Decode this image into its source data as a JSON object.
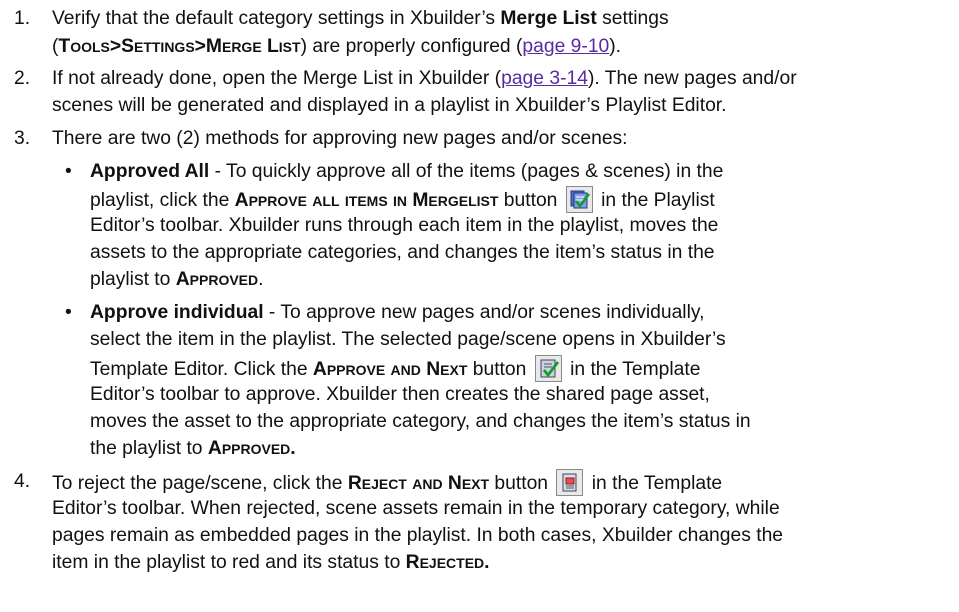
{
  "steps": {
    "s1": {
      "num": "1.",
      "l1_pre": "Verify that the default category settings in Xbuilder’s ",
      "l1_bold": "Merge List",
      "l1_post": " settings",
      "l2_open": "(",
      "l2_path": "Tools>Settings>Merge List",
      "l2_mid": ") are properly configured (",
      "l2_link": "page 9-10",
      "l2_close": ")."
    },
    "s2": {
      "num": "2.",
      "l1_pre": "If not already done, open the Merge List in Xbuilder (",
      "l1_link": "page 3-14",
      "l1_post": "). The new pages and/or",
      "l2": "scenes will be generated and displayed in a playlist in Xbuilder’s Playlist Editor."
    },
    "s3": {
      "num": "3.",
      "l1": "There are two (2) methods for approving new pages and/or scenes:"
    },
    "bullet_a": {
      "bullet": "•",
      "l1_bold": "Approved All",
      "l1_post": " - To quickly approve all of the items (pages & scenes) in the",
      "l2_pre": "playlist, click the ",
      "l2_sc": "Approve all items in Mergelist",
      "l2_mid": " button ",
      "l2_post": " in the Playlist",
      "l3": "Editor’s toolbar. Xbuilder runs through each item in the playlist, moves the",
      "l4": "assets to the appropriate categories, and changes the item’s status in the",
      "l5_pre": "playlist to ",
      "l5_sc": "Approved",
      "l5_post": "."
    },
    "bullet_b": {
      "bullet": "•",
      "l1_bold": "Approve individual",
      "l1_post": " - To approve new pages and/or scenes individually,",
      "l2": "select the item in the playlist. The selected page/scene opens in Xbuilder’s",
      "l3_pre": "Template Editor. Click the ",
      "l3_sc": "Approve and Next",
      "l3_mid": " button ",
      "l3_post": " in the Template",
      "l4": "Editor’s toolbar to approve. Xbuilder then creates the shared page asset,",
      "l5": "moves the asset to the appropriate category, and changes the item’s status in",
      "l6_pre": "the playlist to ",
      "l6_sc": "Approved."
    },
    "s4": {
      "num": "4.",
      "l1_pre": "To reject the page/scene, click the ",
      "l1_sc": "Reject and Next",
      "l1_mid": " button ",
      "l1_post": " in the Template",
      "l2": "Editor’s toolbar. When rejected, scene assets remain in the temporary category, while",
      "l3": "pages remain as embedded pages in the playlist. In both cases, Xbuilder changes the",
      "l4_pre": "item in the playlist to red and its status to ",
      "l4_sc": "Rejected."
    }
  },
  "icons": {
    "approve_all": "approve-all-mergelist-icon",
    "approve_next": "approve-and-next-icon",
    "reject_next": "reject-and-next-icon"
  },
  "colors": {
    "link": "#5a2aa0",
    "text": "#111111",
    "check": "#1a9a2a"
  }
}
